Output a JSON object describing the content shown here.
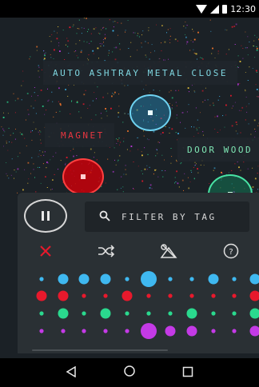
{
  "status_bar": {
    "time": "12:30"
  },
  "map": {
    "labels": {
      "auto": "AUTO ASHTRAY METAL CLOSE",
      "magnet": "MAGNET",
      "door": "DOOR WOOD"
    }
  },
  "filter": {
    "placeholder": "FILTER BY TAG"
  },
  "toolbar": {
    "icons": [
      "close-icon",
      "shuffle-icon",
      "pattern-icon",
      "help-icon"
    ]
  },
  "dot_grid": {
    "rows": [
      {
        "color": "#3fb8f0",
        "sizes": [
          1,
          2,
          2,
          2,
          1,
          3,
          1,
          1,
          2,
          1,
          2
        ]
      },
      {
        "color": "#e8192c",
        "sizes": [
          2,
          2,
          1,
          1,
          2,
          1,
          1,
          1,
          1,
          1,
          2
        ]
      },
      {
        "color": "#2ad98e",
        "sizes": [
          1,
          2,
          1,
          2,
          1,
          1,
          1,
          2,
          1,
          1,
          2
        ]
      },
      {
        "color": "#c43ae6",
        "sizes": [
          1,
          1,
          1,
          1,
          1,
          3,
          2,
          2,
          1,
          1,
          2
        ]
      }
    ]
  },
  "colors": {
    "blue": "#3fb8f0",
    "red": "#e8192c",
    "green": "#2ad98e",
    "purple": "#c43ae6"
  }
}
